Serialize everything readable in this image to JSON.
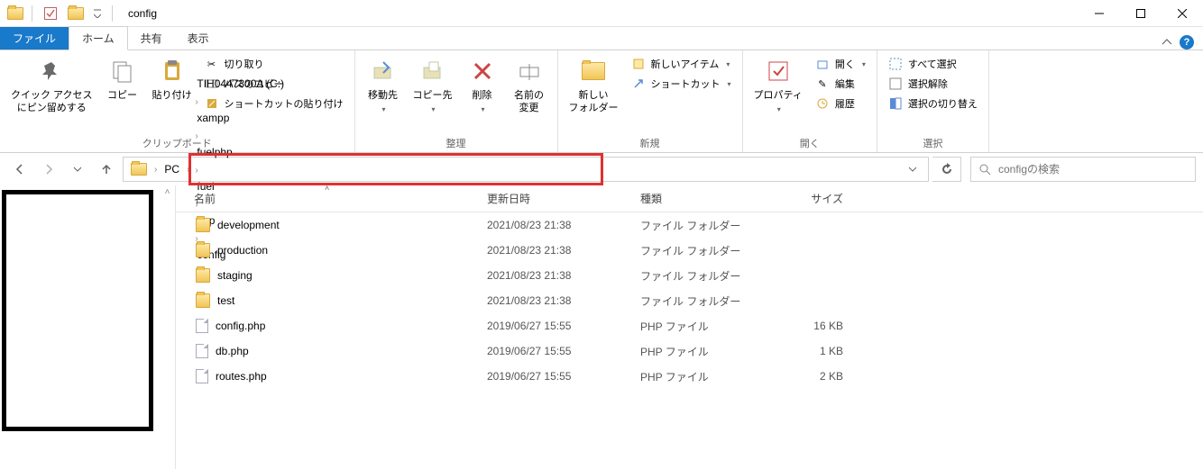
{
  "window": {
    "title": "config"
  },
  "tabs": {
    "file": "ファイル",
    "home": "ホーム",
    "share": "共有",
    "view": "表示"
  },
  "ribbon": {
    "clipboard": {
      "label": "クリップボード",
      "quick_access": "クイック アクセス\nにピン留めする",
      "copy": "コピー",
      "paste": "貼り付け",
      "cut": "切り取り",
      "copy_path": "パスのコピー",
      "paste_shortcut": "ショートカットの貼り付け"
    },
    "organize": {
      "label": "整理",
      "move_to": "移動先",
      "copy_to": "コピー先",
      "delete": "削除",
      "rename": "名前の\n変更"
    },
    "new": {
      "label": "新規",
      "new_folder": "新しい\nフォルダー",
      "new_item": "新しいアイテム",
      "shortcut": "ショートカット"
    },
    "open": {
      "label": "開く",
      "properties": "プロパティ",
      "open": "開く",
      "edit": "編集",
      "history": "履歴"
    },
    "select": {
      "label": "選択",
      "select_all": "すべて選択",
      "select_none": "選択解除",
      "invert": "選択の切り替え"
    }
  },
  "breadcrumb": {
    "pc": "PC",
    "parts": [
      "TIH0447300A (C:)",
      "xampp",
      "fuelphp",
      "fuel",
      "app",
      "config"
    ]
  },
  "search": {
    "placeholder": "configの検索"
  },
  "columns": {
    "name": "名前",
    "date": "更新日時",
    "type": "種類",
    "size": "サイズ"
  },
  "files": [
    {
      "icon": "folder",
      "name": "development",
      "date": "2021/08/23 21:38",
      "type": "ファイル フォルダー",
      "size": ""
    },
    {
      "icon": "folder",
      "name": "production",
      "date": "2021/08/23 21:38",
      "type": "ファイル フォルダー",
      "size": ""
    },
    {
      "icon": "folder",
      "name": "staging",
      "date": "2021/08/23 21:38",
      "type": "ファイル フォルダー",
      "size": ""
    },
    {
      "icon": "folder",
      "name": "test",
      "date": "2021/08/23 21:38",
      "type": "ファイル フォルダー",
      "size": ""
    },
    {
      "icon": "php",
      "name": "config.php",
      "date": "2019/06/27 15:55",
      "type": "PHP ファイル",
      "size": "16 KB"
    },
    {
      "icon": "php",
      "name": "db.php",
      "date": "2019/06/27 15:55",
      "type": "PHP ファイル",
      "size": "1 KB"
    },
    {
      "icon": "php",
      "name": "routes.php",
      "date": "2019/06/27 15:55",
      "type": "PHP ファイル",
      "size": "2 KB"
    }
  ]
}
